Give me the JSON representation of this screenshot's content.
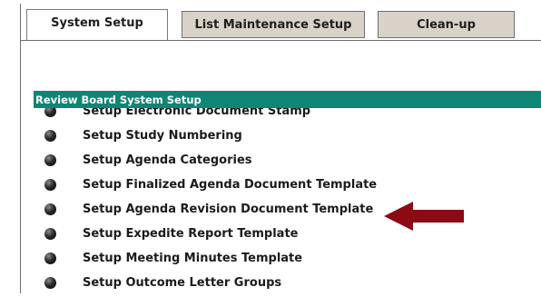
{
  "tabs": [
    {
      "label": "System Setup",
      "active": true
    },
    {
      "label": "List Maintenance Setup",
      "active": false
    },
    {
      "label": "Clean-up",
      "active": false
    }
  ],
  "section": {
    "title": "Review Board System Setup"
  },
  "items": [
    {
      "label": "Setup Electronic Document Stamp"
    },
    {
      "label": "Setup Study Numbering"
    },
    {
      "label": "Setup Agenda Categories"
    },
    {
      "label": "Setup Finalized Agenda Document Template"
    },
    {
      "label": "Setup Agenda Revision Document Template"
    },
    {
      "label": "Setup Expedite Report Template"
    },
    {
      "label": "Setup Meeting Minutes Template"
    },
    {
      "label": "Setup Outcome Letter Groups"
    }
  ],
  "colors": {
    "header_bg": "#0f8575",
    "tab_inactive_bg": "#d8d2c8",
    "arrow": "#8b0a14"
  },
  "icons": {
    "bullet": "black-circle-bullet-icon",
    "callout": "left-arrow-icon"
  }
}
